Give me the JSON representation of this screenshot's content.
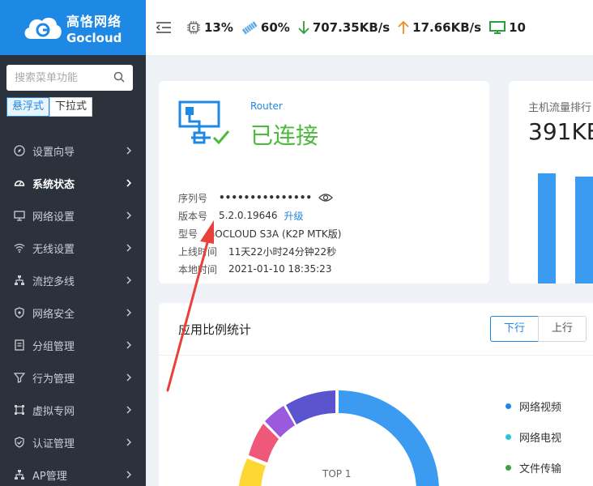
{
  "brand": {
    "cn": "高恪网络",
    "en": "Gocloud",
    "color": "#1e88e5"
  },
  "search": {
    "placeholder": "搜索菜单功能"
  },
  "menu_modes": [
    "悬浮式",
    "下拉式"
  ],
  "nav": [
    {
      "label": "设置向导",
      "icon": "compass-icon"
    },
    {
      "label": "系统状态",
      "icon": "gauge-icon",
      "active": true
    },
    {
      "label": "网络设置",
      "icon": "monitor-icon"
    },
    {
      "label": "无线设置",
      "icon": "wifi-icon"
    },
    {
      "label": "流控多线",
      "icon": "network-tree-icon"
    },
    {
      "label": "网络安全",
      "icon": "shield-icon"
    },
    {
      "label": "分组管理",
      "icon": "group-icon"
    },
    {
      "label": "行为管理",
      "icon": "filter-icon"
    },
    {
      "label": "虚拟专网",
      "icon": "vpn-icon"
    },
    {
      "label": "认证管理",
      "icon": "verified-shield-icon"
    },
    {
      "label": "AP管理",
      "icon": "ap-tree-icon"
    }
  ],
  "topbar": {
    "cpu": "13%",
    "memory": "60%",
    "download": "707.35KB/s",
    "upload": "17.66KB/s",
    "hosts": "10"
  },
  "router_card": {
    "type_label": "Router",
    "status": "已连接",
    "rows": {
      "serial_key": "序列号",
      "serial_value": "•••••••••••••••",
      "version_key": "版本号",
      "version_value": "5.2.0.19646",
      "upgrade": "升级",
      "model_key": "型号",
      "model_value": "GOCLOUD S3A (K2P MTK版)",
      "uptime_key": "上线时间",
      "uptime_value": "11天22小时24分钟22秒",
      "localtime_key": "本地时间",
      "localtime_value": "2021-01-10 18:35:23"
    }
  },
  "flow_card": {
    "title": "主机流量排行",
    "value": "391KB"
  },
  "app_card": {
    "title": "应用比例统计",
    "tabs": [
      "下行",
      "上行"
    ],
    "center_label": "TOP 1",
    "legend": [
      {
        "label": "网络视频",
        "color": "#1e88e5"
      },
      {
        "label": "网络电视",
        "color": "#26c6da"
      },
      {
        "label": "文件传输",
        "color": "#43a047"
      }
    ]
  },
  "colors": {
    "sidebar": "#2b323c",
    "success": "#4cbb3b",
    "accent": "#1e88e5"
  }
}
